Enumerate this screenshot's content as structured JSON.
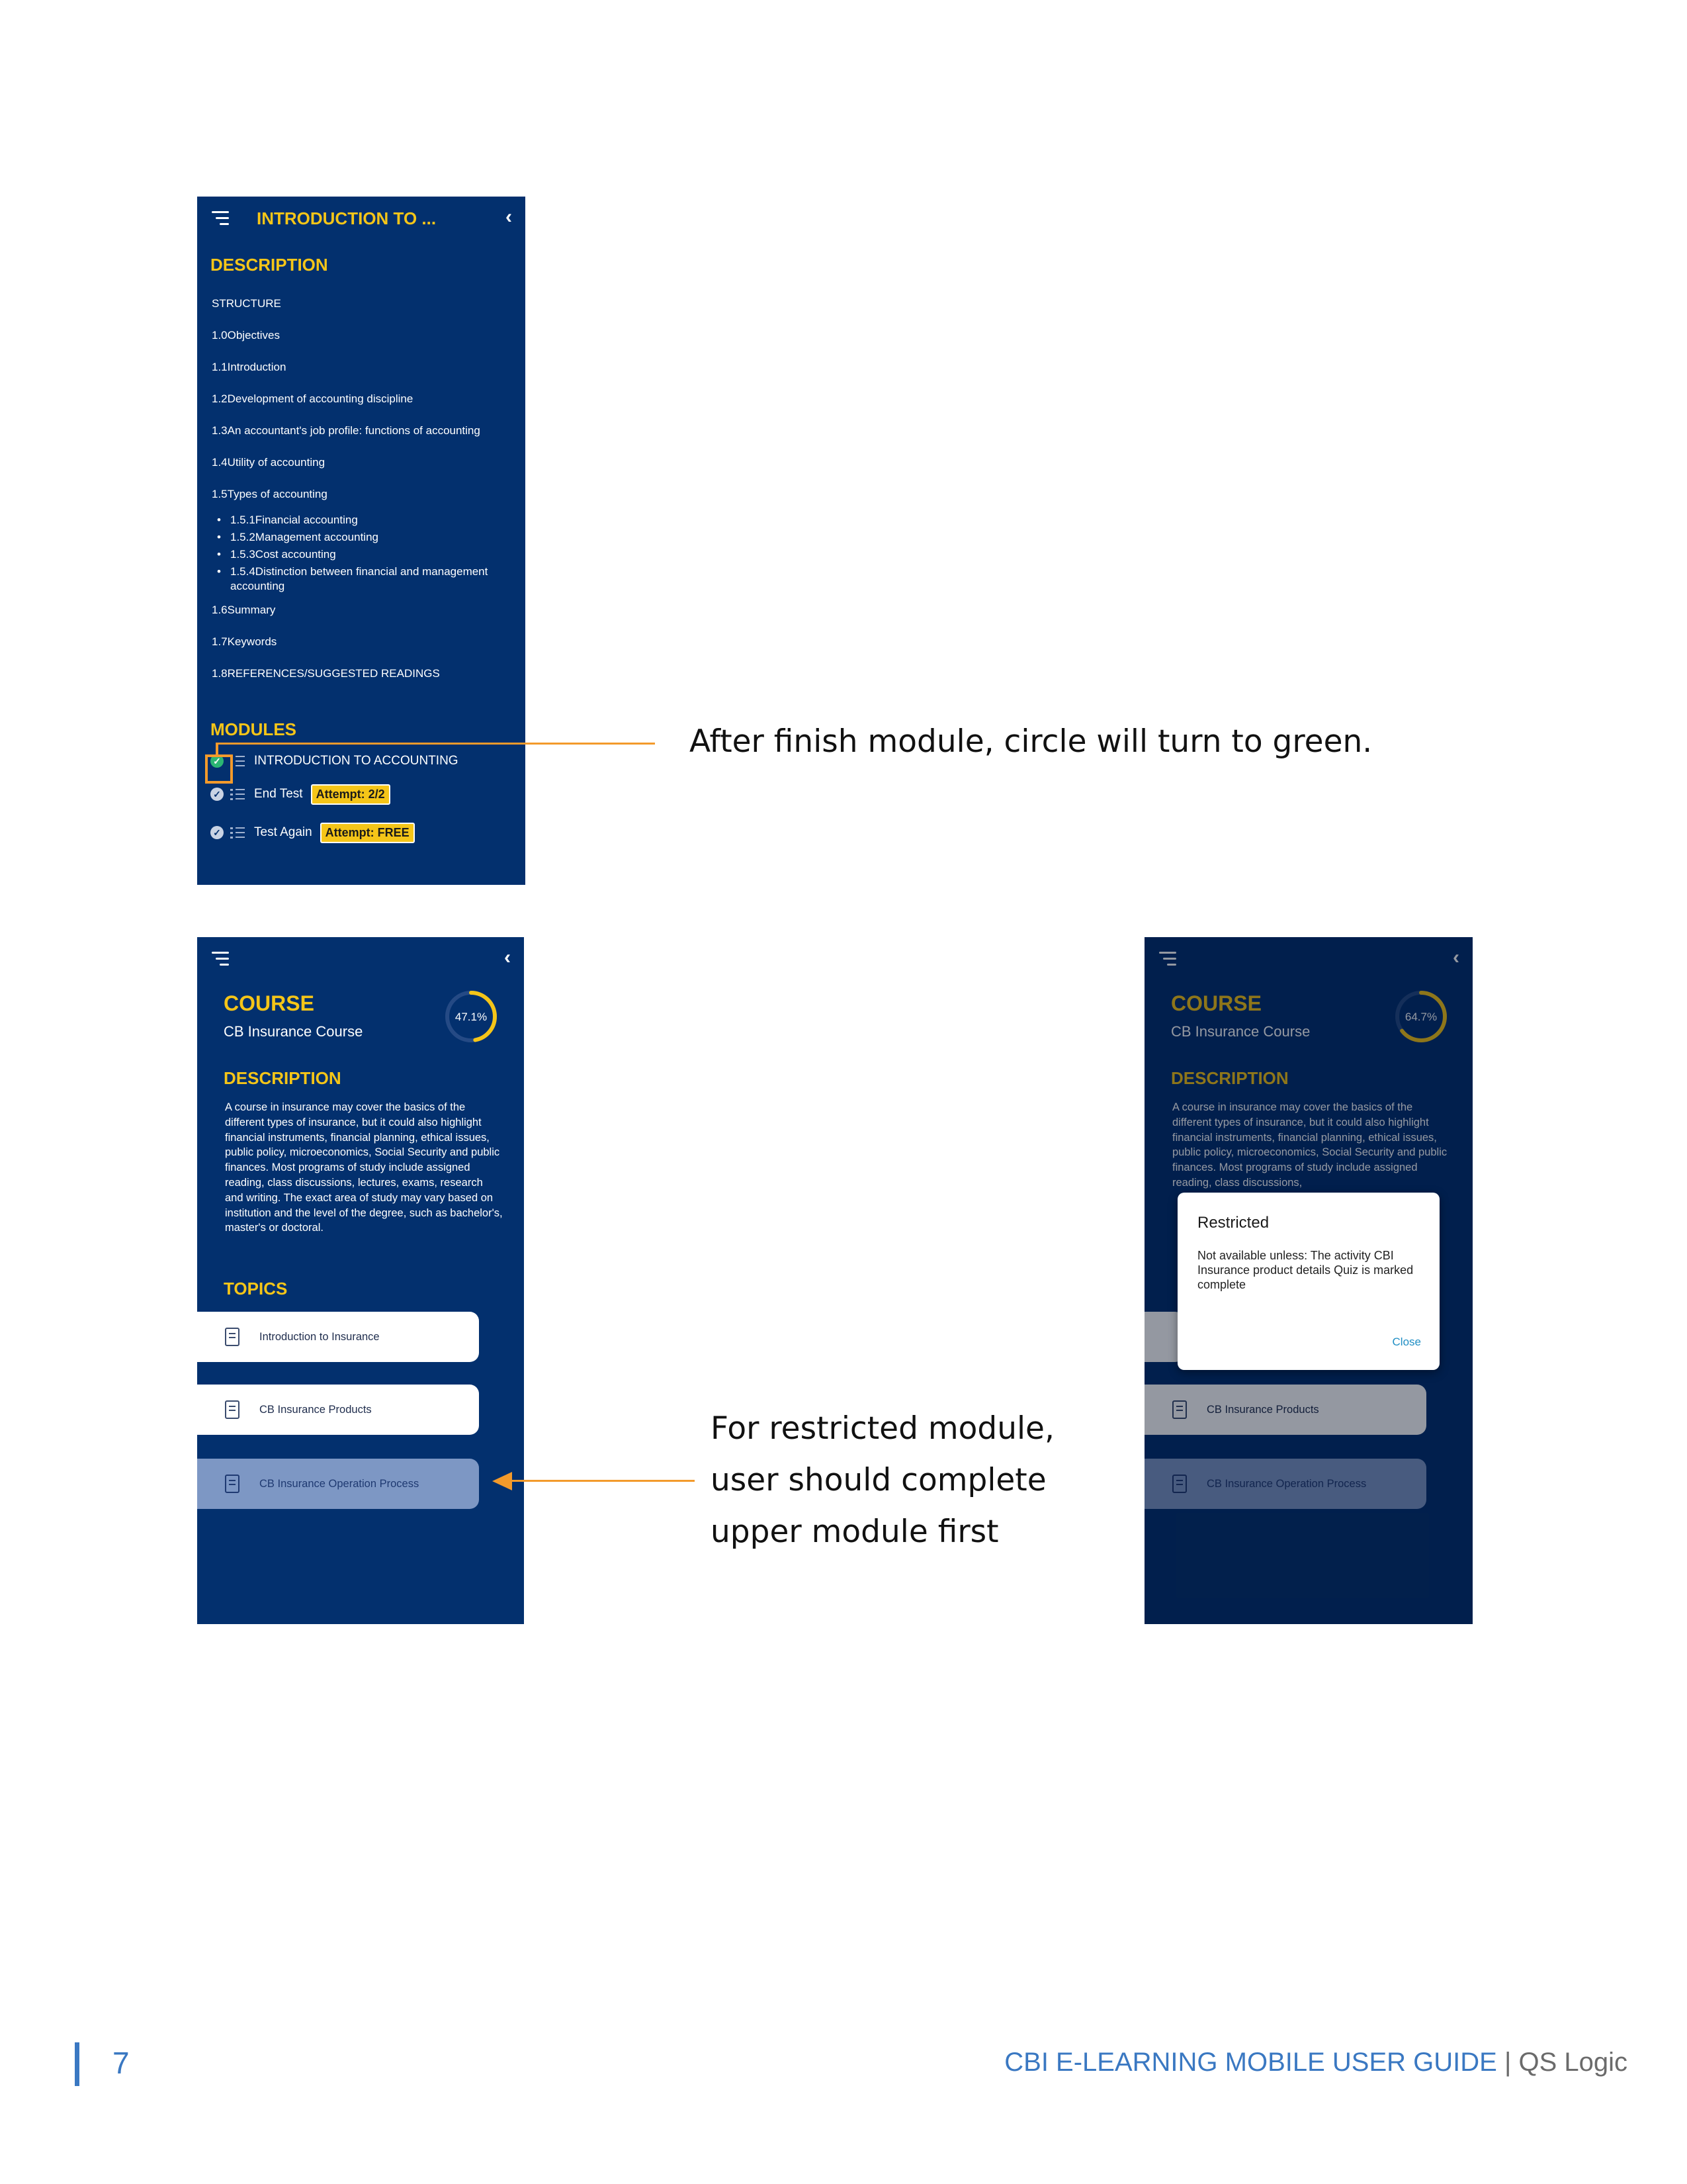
{
  "screen1": {
    "header_title": "INTRODUCTION TO ...",
    "description_heading": "DESCRIPTION",
    "toc": [
      "STRUCTURE",
      "1.0Objectives",
      "1.1Introduction",
      "1.2Development of accounting discipline",
      "1.3An accountant's job profile: functions of accounting",
      "1.4Utility of accounting",
      "1.5Types of accounting"
    ],
    "bullets": [
      "1.5.1Financial accounting",
      "1.5.2Management accounting",
      "1.5.3Cost accounting",
      "1.5.4Distinction between financial and management accounting"
    ],
    "toc2": [
      "1.6Summary",
      "1.7Keywords",
      "1.8REFERENCES/SUGGESTED READINGS"
    ],
    "modules_heading": "MODULES",
    "modules": [
      {
        "label": "INTRODUCTION TO ACCOUNTING",
        "badge": "",
        "completed": true
      },
      {
        "label": "End Test",
        "badge": "Attempt: 2/2",
        "completed": false
      },
      {
        "label": "Test Again",
        "badge": "Attempt: FREE",
        "completed": false
      }
    ]
  },
  "screen2": {
    "course_heading": "COURSE",
    "course_name": "CB Insurance Course",
    "progress_label": "47.1%",
    "progress_value": 47.1,
    "description_heading": "DESCRIPTION",
    "description_text": "A course in insurance may cover the basics of the different types of insurance, but it could also highlight financial instruments, financial planning, ethical issues, public policy, microeconomics, Social Security and public finances. Most programs of study include assigned reading, class discussions, lectures, exams, research and writing. The exact area of study may vary based on institution and the level of the degree, such as bachelor's, master's or doctoral.",
    "topics_heading": "TOPICS",
    "topics": [
      "Introduction to Insurance",
      "CB Insurance Products",
      "CB Insurance Operation Process"
    ]
  },
  "screen3": {
    "course_heading": "COURSE",
    "course_name": "CB Insurance Course",
    "progress_label": "64.7%",
    "progress_value": 64.7,
    "description_heading": "DESCRIPTION",
    "description_text": "A course in insurance may cover the basics of the different types of insurance, but it could also highlight financial instruments, financial planning, ethical issues, public policy, microeconomics, Social Security and public finances. Most programs of study include assigned reading, class discussions,",
    "topics": [
      "CB Insurance Products",
      "CB Insurance Operation Process"
    ],
    "dialog": {
      "title": "Restricted",
      "message": "Not available unless: The activity CBI Insurance product details Quiz is marked complete",
      "close_label": "Close"
    }
  },
  "captions": {
    "green_circle": "After finish module, circle will turn to green.",
    "restricted_lines": [
      "For restricted module,",
      "user should complete",
      "upper module first"
    ]
  },
  "footer": {
    "page_number": "7",
    "guide_title": "CBI E-LEARNING MOBILE USER GUIDE",
    "separator": " | ",
    "company": "QS Logic"
  },
  "colors": {
    "app_bg": "#03306e",
    "accent": "#f5c518",
    "annotation": "#f39a2b",
    "footer_blue": "#3a78c2"
  }
}
